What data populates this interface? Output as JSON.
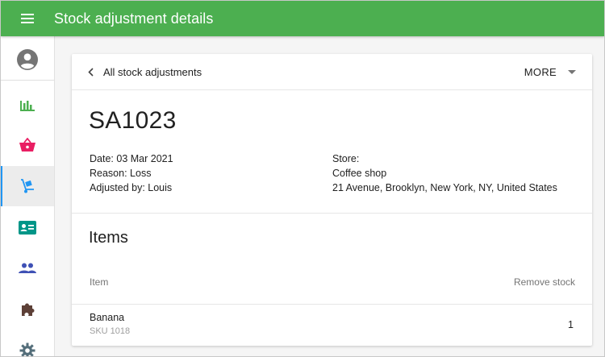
{
  "app": {
    "title": "Stock adjustment details",
    "accent": "#4caf50"
  },
  "sidebar": {
    "items": [
      {
        "icon": "account-circle-icon",
        "color": "#757575"
      },
      {
        "icon": "bar-chart-icon",
        "color": "#4caf50"
      },
      {
        "icon": "basket-icon",
        "color": "#e91e63"
      },
      {
        "icon": "hand-truck-icon",
        "color": "#2196f3",
        "active": true
      },
      {
        "icon": "id-card-icon",
        "color": "#009688"
      },
      {
        "icon": "people-icon",
        "color": "#3f51b5"
      },
      {
        "icon": "puzzle-icon",
        "color": "#5d4037"
      },
      {
        "icon": "gear-icon",
        "color": "#546e7a"
      }
    ]
  },
  "header": {
    "back_label": "All stock adjustments",
    "more_label": "MORE"
  },
  "adjustment": {
    "id": "SA1023",
    "date_label": "Date:",
    "date_value": "03 Mar 2021",
    "reason_label": "Reason:",
    "reason_value": "Loss",
    "adjusted_by_label": "Adjusted by:",
    "adjusted_by_value": "Louis",
    "store_label": "Store:",
    "store_name": "Coffee shop",
    "store_address": "21 Avenue, Brooklyn, New York, NY, United States"
  },
  "items": {
    "title": "Items",
    "columns": {
      "item": "Item",
      "remove": "Remove stock"
    },
    "rows": [
      {
        "name": "Banana",
        "sku": "SKU 1018",
        "qty": "1"
      }
    ]
  }
}
